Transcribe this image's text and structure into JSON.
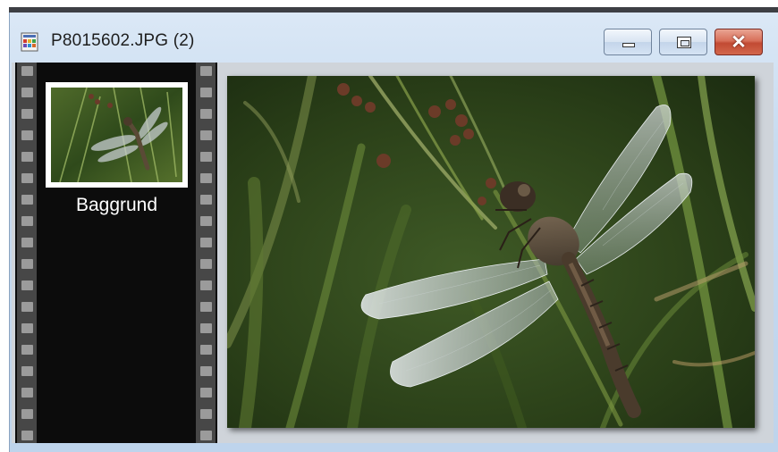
{
  "window": {
    "title": "P8015602.JPG (2)",
    "icon": "image-document-icon",
    "controls": {
      "minimize_icon": "minimize-icon",
      "maximize_icon": "restore-icon",
      "close_icon": "close-icon",
      "close_glyph": "✕"
    }
  },
  "filmstrip": {
    "frames": [
      {
        "label": "Baggrund",
        "thumbnail": "dragonfly-on-grass"
      }
    ]
  },
  "viewer": {
    "image": "dragonfly-on-grass"
  },
  "colors": {
    "titlebar": "#c7dbf0",
    "filmstrip_bg": "#0c0c0c",
    "perforation": "#9b9b9b",
    "close_button": "#c24a33"
  }
}
